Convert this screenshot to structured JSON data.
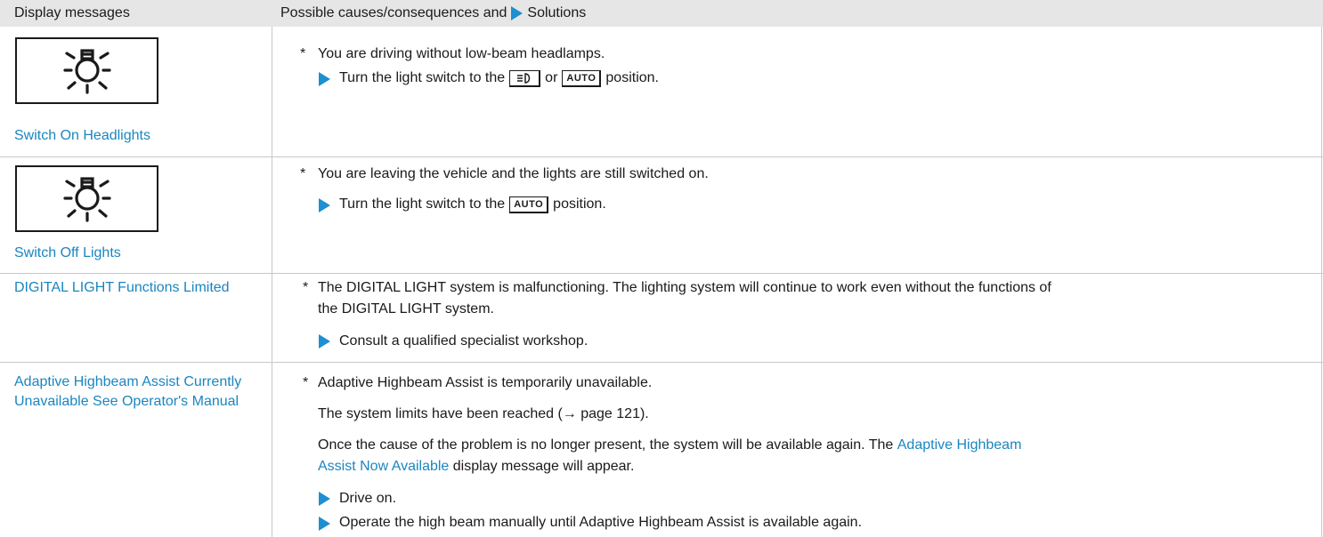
{
  "header": {
    "col1": "Display messages",
    "col2_before": "Possible causes/consequences and",
    "col2_after": "Solutions"
  },
  "rows": [
    {
      "message": "Switch On Headlights",
      "icon": "light-bulb-icon",
      "cause": "You are driving without low-beam headlamps.",
      "solution_before": "Turn the light switch to the",
      "solution_key1": "headlamp-symbol",
      "solution_or": "or",
      "solution_key2": "AUTO",
      "solution_after": "position."
    },
    {
      "message": "Switch Off Lights",
      "icon": "light-bulb-icon",
      "cause": "You are leaving the vehicle and the lights are still switched on.",
      "solution_before": "Turn the light switch to the",
      "solution_key": "AUTO",
      "solution_after": "position."
    },
    {
      "message": "DIGITAL LIGHT Functions Limited",
      "cause_line1": "The DIGITAL LIGHT system is malfunctioning. The lighting system will continue to work even without the functions of",
      "cause_line2": "the DIGITAL LIGHT system.",
      "solution": "Consult a qualified specialist workshop."
    },
    {
      "message": "Adaptive Highbeam Assist Currently Unavailable See Operator's Manual",
      "cause": "Adaptive Highbeam Assist is temporarily unavailable.",
      "limits": "The system limits have been reached (→ page 121).",
      "once_line1": "Once the cause of the problem is no longer present, the system will be available again. The",
      "once_link1": "Adaptive Highbeam",
      "once_link2": "Assist Now Available",
      "once_line2_after": "display message will appear.",
      "solution1": "Drive on.",
      "solution2": "Operate the high beam manually until Adaptive Highbeam Assist is available again."
    }
  ],
  "colors": {
    "accent": "#1e8fd0",
    "link": "#1a86c0",
    "header_bg": "#e6e6e6"
  }
}
